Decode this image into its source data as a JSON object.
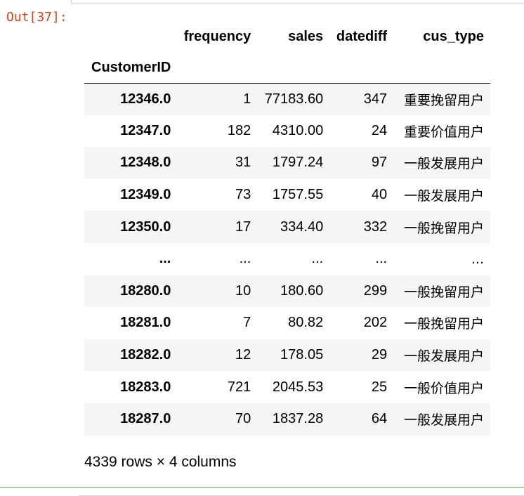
{
  "output": {
    "prompt": "Out[37]:"
  },
  "table": {
    "columns": [
      "frequency",
      "sales",
      "datediff",
      "cus_type"
    ],
    "index_name": "CustomerID",
    "rows": [
      {
        "index": "12346.0",
        "frequency": "1",
        "sales": "77183.60",
        "datediff": "347",
        "cus_type": "重要挽留用户"
      },
      {
        "index": "12347.0",
        "frequency": "182",
        "sales": "4310.00",
        "datediff": "24",
        "cus_type": "重要价值用户"
      },
      {
        "index": "12348.0",
        "frequency": "31",
        "sales": "1797.24",
        "datediff": "97",
        "cus_type": "一般发展用户"
      },
      {
        "index": "12349.0",
        "frequency": "73",
        "sales": "1757.55",
        "datediff": "40",
        "cus_type": "一般发展用户"
      },
      {
        "index": "12350.0",
        "frequency": "17",
        "sales": "334.40",
        "datediff": "332",
        "cus_type": "一般挽留用户"
      },
      {
        "index": "...",
        "frequency": "...",
        "sales": "...",
        "datediff": "...",
        "cus_type": "..."
      },
      {
        "index": "18280.0",
        "frequency": "10",
        "sales": "180.60",
        "datediff": "299",
        "cus_type": "一般挽留用户"
      },
      {
        "index": "18281.0",
        "frequency": "7",
        "sales": "80.82",
        "datediff": "202",
        "cus_type": "一般挽留用户"
      },
      {
        "index": "18282.0",
        "frequency": "12",
        "sales": "178.05",
        "datediff": "29",
        "cus_type": "一般发展用户"
      },
      {
        "index": "18283.0",
        "frequency": "721",
        "sales": "2045.53",
        "datediff": "25",
        "cus_type": "一般价值用户"
      },
      {
        "index": "18287.0",
        "frequency": "70",
        "sales": "1837.28",
        "datediff": "64",
        "cus_type": "一般发展用户"
      }
    ],
    "shape_text": "4339 rows × 4 columns"
  },
  "colors": {
    "prompt": "#d84315",
    "row_stripe": "#f5f5f5",
    "cell_divider": "#66bb6a"
  }
}
